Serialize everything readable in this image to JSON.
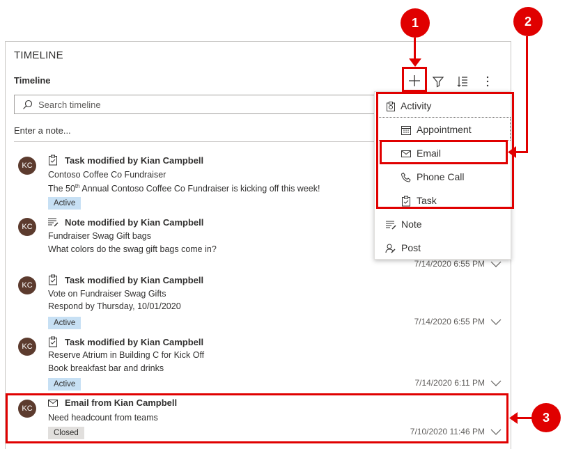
{
  "panel": {
    "section_title": "TIMELINE",
    "timeline_label": "Timeline",
    "search_placeholder": "Search timeline",
    "note_placeholder": "Enter a note..."
  },
  "toolbar": {
    "add_icon": "plus-icon",
    "filter_icon": "filter-icon",
    "sort_icon": "sort-icon",
    "more_icon": "more-icon"
  },
  "items": [
    {
      "avatar": "KC",
      "icon": "task-icon",
      "title": "Task modified by Kian Campbell",
      "line1": "Contoso Coffee Co Fundraiser",
      "line2": "The 50th Annual Contoso Coffee Co Fundraiser is kicking off this week!",
      "badge": "Active",
      "timestamp": ""
    },
    {
      "avatar": "KC",
      "icon": "note-icon",
      "title": "Note modified by Kian Campbell",
      "line1": "Fundraiser Swag Gift bags",
      "line2": "What colors do the swag gift bags come in?",
      "badge": "",
      "timestamp": "7/14/2020 6:55 PM"
    },
    {
      "avatar": "KC",
      "icon": "task-icon",
      "title": "Task modified by Kian Campbell",
      "line1": "Vote on Fundraiser Swag Gifts",
      "line2": "Respond by Thursday, 10/01/2020",
      "badge": "Active",
      "timestamp": "7/14/2020 6:55 PM"
    },
    {
      "avatar": "KC",
      "icon": "task-icon",
      "title": "Task modified by Kian Campbell",
      "line1": "Reserve Atrium in Building C for Kick Off",
      "line2": "Book breakfast bar and drinks",
      "badge": "Active",
      "timestamp": "7/14/2020 6:11 PM"
    },
    {
      "avatar": "KC",
      "icon": "email-icon",
      "title": "Email from Kian Campbell",
      "line1": "Need headcount from teams",
      "line2": "",
      "badge": "Closed",
      "timestamp": "7/10/2020 11:46 PM"
    }
  ],
  "menu": {
    "activity": "Activity",
    "appointment": "Appointment",
    "email": "Email",
    "phone_call": "Phone Call",
    "task": "Task",
    "note": "Note",
    "post": "Post"
  },
  "callouts": [
    "1",
    "2",
    "3"
  ],
  "colors": {
    "highlight": "#e00000",
    "avatar": "#5c3b2e",
    "active_badge": "#c7e0f4",
    "closed_badge": "#e1dfdd"
  }
}
